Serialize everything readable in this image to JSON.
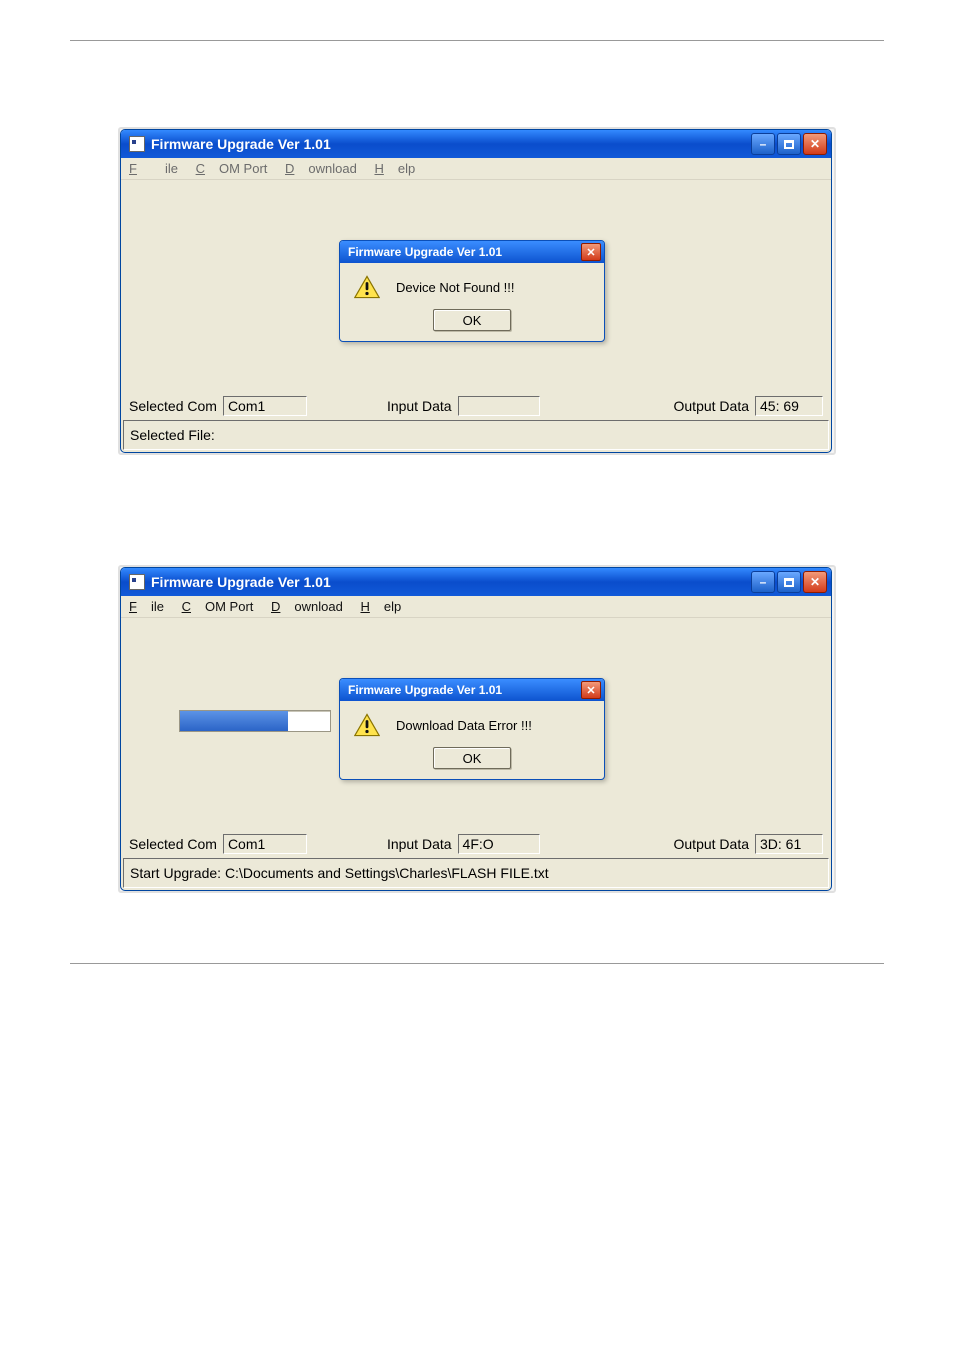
{
  "window": {
    "title": "Firmware Upgrade Ver 1.01",
    "menu": {
      "file": "File",
      "comport": "COM Port",
      "download": "Download",
      "help": "Help"
    }
  },
  "dialog1": {
    "title": "Firmware Upgrade Ver 1.01",
    "message": "Device Not Found !!!",
    "ok": "OK"
  },
  "dialog2": {
    "title": "Firmware Upgrade Ver 1.01",
    "message": "Download Data Error !!!",
    "ok": "OK"
  },
  "status1": {
    "selected_com_label": "Selected Com",
    "selected_com_value": "Com1",
    "input_label": "Input Data",
    "input_value": "",
    "output_label": "Output Data",
    "output_value": "45: 69",
    "file_line": "Selected File:"
  },
  "status2": {
    "selected_com_label": "Selected Com",
    "selected_com_value": "Com1",
    "input_label": "Input Data",
    "input_value": "4F:O",
    "output_label": "Output Data",
    "output_value": "3D: 61",
    "file_line": "Start Upgrade: C:\\Documents and Settings\\Charles\\FLASH FILE.txt"
  }
}
